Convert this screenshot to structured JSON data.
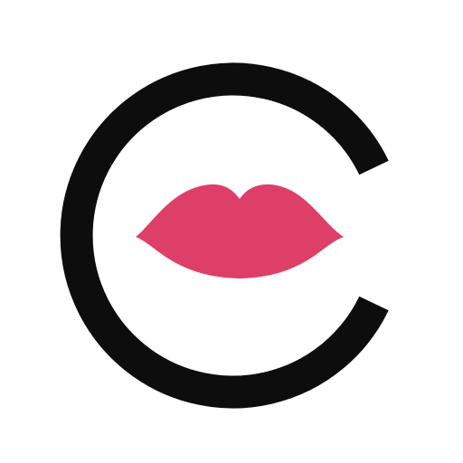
{
  "app_icon": {
    "name": "app-icon-logo",
    "icons": [
      "c-ring-icon",
      "lips-icon"
    ],
    "colors": {
      "background": "#ffffff",
      "ring": "#0d0d0d",
      "lips": "#de3f68"
    }
  }
}
